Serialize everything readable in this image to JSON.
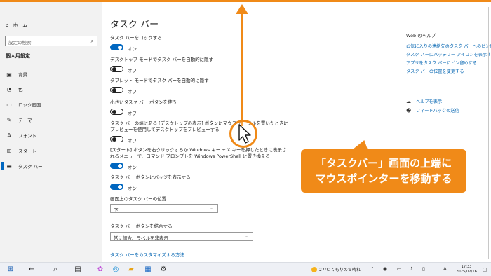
{
  "sidebar": {
    "home": "ホーム",
    "search_placeholder": "設定の検索",
    "section": "個人用設定",
    "items": [
      {
        "label": "背景",
        "icon": "image-icon"
      },
      {
        "label": "色",
        "icon": "palette-icon"
      },
      {
        "label": "ロック画面",
        "icon": "lock-screen-icon"
      },
      {
        "label": "テーマ",
        "icon": "theme-icon"
      },
      {
        "label": "フォント",
        "icon": "font-icon"
      },
      {
        "label": "スタート",
        "icon": "start-icon"
      },
      {
        "label": "タスク バー",
        "icon": "taskbar-icon"
      }
    ]
  },
  "main": {
    "title": "タスク バー",
    "settings": [
      {
        "label": "タスク バーをロックする",
        "state": "オン"
      },
      {
        "label": "デスクトップ モードでタスク バーを自動的に隠す",
        "state": "オフ"
      },
      {
        "label": "タブレット モードでタスク バーを自動的に隠す",
        "state": "オフ"
      },
      {
        "label": "小さいタスク バー ボタンを使う",
        "state": "オフ"
      },
      {
        "label_1": "タスク バーの端にある [デスクトップの表示] ボタンにマウス カーソルを置いたときに",
        "label_2": "プレビューを使用してデスクトップをプレビューする",
        "state": "オフ"
      },
      {
        "label_1": "[スタート] ボタンを右クリックするか Windows キー + X キーを押したときに表示さ",
        "label_2": "れるメニューで、コマンド プロンプトを Windows PowerShell に置き換える",
        "state": "オン"
      },
      {
        "label": "タスク バー ボタンにバッジを表示する",
        "state": "オン"
      }
    ],
    "position_label": "画面上のタスク バーの位置",
    "position_value": "下",
    "combine_label": "タスク バー ボタンを結合する",
    "combine_value": "常に結合、ラベルを非表示",
    "customize_link": "タスク バーをカスタマイズする方法"
  },
  "help": {
    "title": "Web のヘルプ",
    "links": [
      "お気に入りの連絡先のタスク バーへのピン留め",
      "タスク バーにバッテリー アイコンを表示する",
      "アプリをタスク バーにピン留めする",
      "タスク バーの位置を変更する"
    ],
    "get_help": "ヘルプを表示",
    "feedback": "フィードバックの送信"
  },
  "callout": {
    "line1": "「タスクバー」画面の上端に",
    "line2": "マウスポインターを移動する"
  },
  "taskbar": {
    "weather": "27°C くもりのち晴れ",
    "ime": "A",
    "time": "17:33",
    "date": "2025/07/16"
  },
  "colors": {
    "accent": "#0067c0",
    "annotation": "#f08a18"
  }
}
